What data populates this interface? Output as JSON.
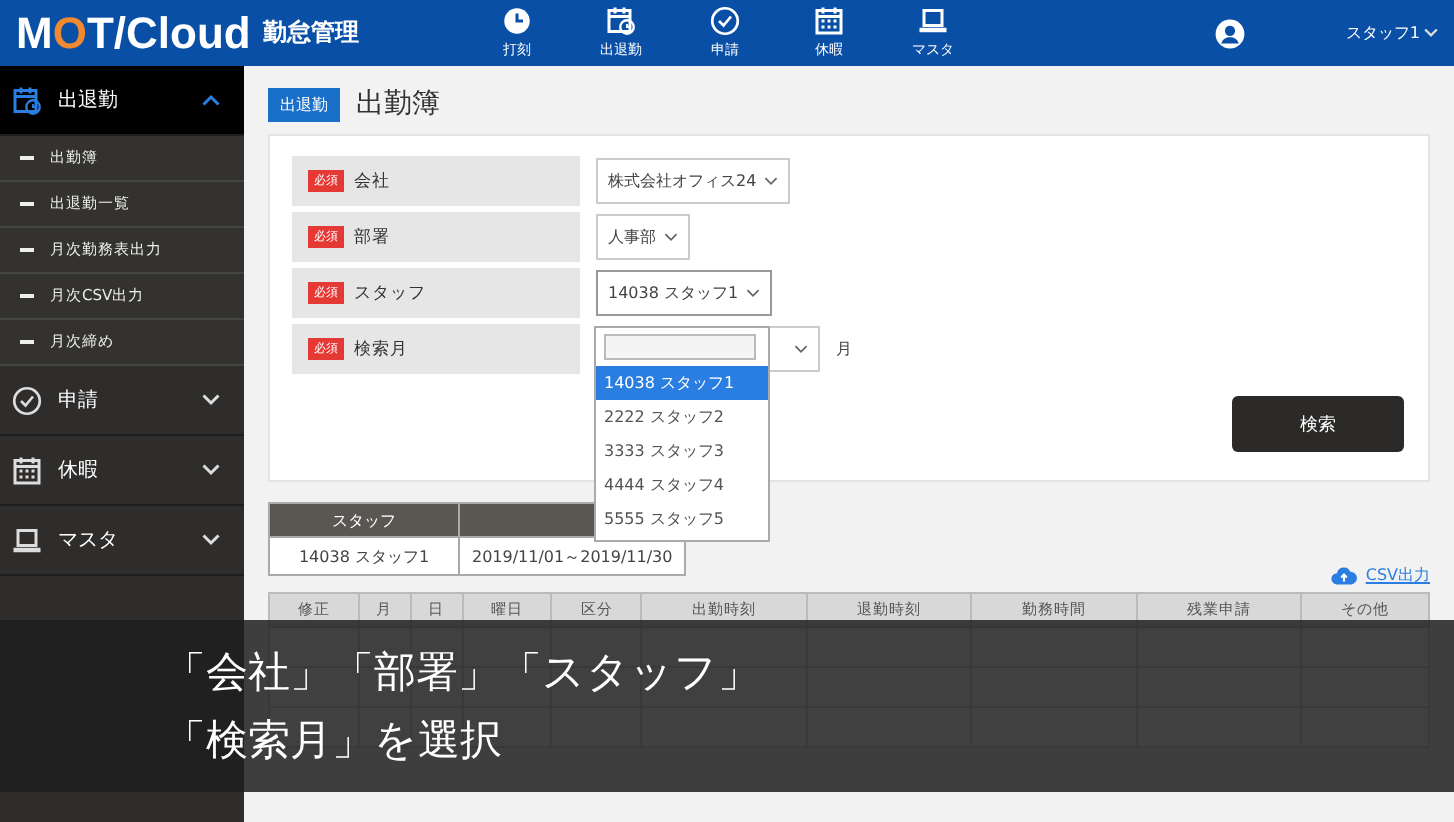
{
  "header": {
    "logo": {
      "before": "M",
      "ring": "O",
      "after": "T/Cloud"
    },
    "app_name": "勤怠管理",
    "nav": [
      {
        "label": "打刻",
        "kind": "clock"
      },
      {
        "label": "出退勤",
        "kind": "attendance"
      },
      {
        "label": "申請",
        "kind": "request"
      },
      {
        "label": "休暇",
        "kind": "leave"
      },
      {
        "label": "マスタ",
        "kind": "master"
      }
    ],
    "user": "スタッフ1"
  },
  "sidebar": [
    {
      "label": "出退勤",
      "kind": "attendance",
      "expanded": true,
      "children": [
        {
          "label": "出勤簿"
        },
        {
          "label": "出退勤一覧"
        },
        {
          "label": "月次勤務表出力"
        },
        {
          "label": "月次CSV出力"
        },
        {
          "label": "月次締め"
        }
      ]
    },
    {
      "label": "申請",
      "kind": "request",
      "expanded": false
    },
    {
      "label": "休暇",
      "kind": "leave",
      "expanded": false
    },
    {
      "label": "マスタ",
      "kind": "master",
      "expanded": false
    }
  ],
  "page": {
    "badge": "出退勤",
    "title": "出勤簿"
  },
  "form": [
    {
      "required": "必須",
      "label": "会社",
      "value": "株式会社オフィス24",
      "open": false
    },
    {
      "required": "必須",
      "label": "部署",
      "value": "人事部",
      "open": false
    },
    {
      "required": "必須",
      "label": "スタッフ",
      "value": "14038 スタッフ1",
      "open": true
    },
    {
      "required": "必須",
      "label": "検索月",
      "suffix": "月",
      "open": false
    }
  ],
  "dropdown": {
    "options": [
      {
        "label": "14038 スタッフ1",
        "selected": true
      },
      {
        "label": "2222 スタッフ2",
        "selected": false
      },
      {
        "label": "3333 スタッフ3",
        "selected": false
      },
      {
        "label": "4444 スタッフ4",
        "selected": false
      },
      {
        "label": "5555 スタッフ5",
        "selected": false
      }
    ]
  },
  "search_button": "検索",
  "summary": {
    "columns": [
      "スタッフ"
    ],
    "row": [
      "14038 スタッフ1",
      "2019/11/01～2019/11/30"
    ]
  },
  "csv_link": "CSV出力",
  "table": {
    "columns": [
      "修正",
      "月",
      "日",
      "曜日",
      "区分",
      "出勤時刻",
      "退勤時刻",
      "勤務時間",
      "残業申請",
      "その他"
    ]
  },
  "caption": [
    "「会社」「部署」「スタッフ」",
    "「検索月」を選択"
  ]
}
